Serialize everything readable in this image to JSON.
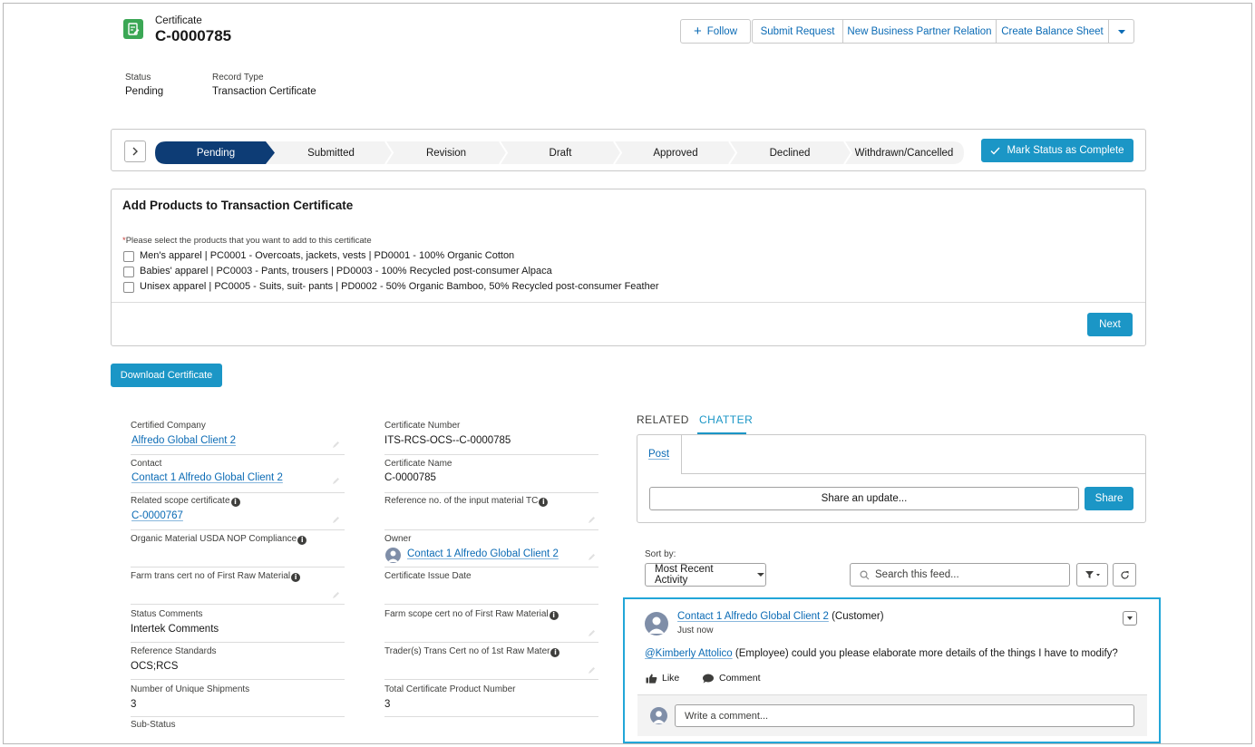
{
  "header": {
    "object_label": "Certificate",
    "record_name": "C-0000785",
    "follow_label": "Follow",
    "actions": [
      "Submit Request",
      "New Business Partner Relation",
      "Create Balance Sheet"
    ]
  },
  "highlights": {
    "status_label": "Status",
    "status_value": "Pending",
    "record_type_label": "Record Type",
    "record_type_value": "Transaction Certificate"
  },
  "path": {
    "stages": [
      "Pending",
      "Submitted",
      "Revision",
      "Draft",
      "Approved",
      "Declined",
      "Withdrawn/Cancelled"
    ],
    "current_stage": "Pending",
    "complete_button": "Mark Status as Complete"
  },
  "products": {
    "title": "Add Products to Transaction Certificate",
    "required_marker": "*",
    "instruction": "Please select the products that you want to add to this certificate",
    "items": [
      "Men's apparel | PC0001 - Overcoats, jackets, vests | PD0001 - 100% Organic Cotton",
      "Babies' apparel | PC0003 - Pants, trousers | PD0003 - 100% Recycled post-consumer Alpaca",
      "Unisex apparel | PC0005 - Suits, suit- pants | PD0002 - 50% Organic Bamboo, 50% Recycled post-consumer Feather"
    ],
    "next_button": "Next"
  },
  "download_button": "Download Certificate",
  "details": {
    "certified_company_label": "Certified Company",
    "certified_company_value": "Alfredo Global Client 2",
    "contact_label": "Contact",
    "contact_value": "Contact 1 Alfredo Global Client 2",
    "related_scope_label": "Related scope certificate",
    "related_scope_value": "C-0000767",
    "usda_label": "Organic Material USDA NOP Compliance",
    "farm_trans_label": "Farm trans cert no of First Raw Material",
    "status_comments_label": "Status Comments",
    "status_comments_value": "Intertek Comments",
    "reference_standards_label": "Reference Standards",
    "reference_standards_value": "OCS;RCS",
    "unique_shipments_label": "Number of Unique Shipments",
    "unique_shipments_value": "3",
    "sub_status_label": "Sub-Status",
    "certificate_number_label": "Certificate Number",
    "certificate_number_value": "ITS-RCS-OCS--C-0000785",
    "certificate_name_label": "Certificate Name",
    "certificate_name_value": "C-0000785",
    "reference_input_label": "Reference no. of the input material TC",
    "owner_label": "Owner",
    "owner_value": "Contact 1 Alfredo Global Client 2",
    "issue_date_label": "Certificate Issue Date",
    "farm_scope_label": "Farm scope cert no of First Raw Material",
    "trader_label": "Trader(s) Trans Cert no of 1st Raw Mater",
    "total_products_label": "Total Certificate Product Number",
    "total_products_value": "3"
  },
  "side_tabs": [
    "RELATED",
    "CHATTER"
  ],
  "publisher": {
    "post_tab": "Post",
    "share_placeholder": "Share an update...",
    "share_button": "Share"
  },
  "feed": {
    "sort_label": "Sort by:",
    "sort_value": "Most Recent Activity",
    "search_placeholder": "Search this feed...",
    "post": {
      "author": "Contact 1 Alfredo Global Client 2",
      "author_role": "(Customer)",
      "time": "Just now",
      "mention": "@Kimberly Attolico",
      "body": "(Employee) could you please elaborate more details of the things I have to modify?",
      "like_label": "Like",
      "comment_label": "Comment",
      "comment_placeholder": "Write a comment..."
    }
  },
  "colors": {
    "brand": "#1b96c6",
    "path_current": "#0d3c75",
    "path_incomplete": "#f3f3f3",
    "link": "#0b6bb5",
    "record_icon": "#3ba755",
    "highlight_border": "#22a6d8"
  }
}
